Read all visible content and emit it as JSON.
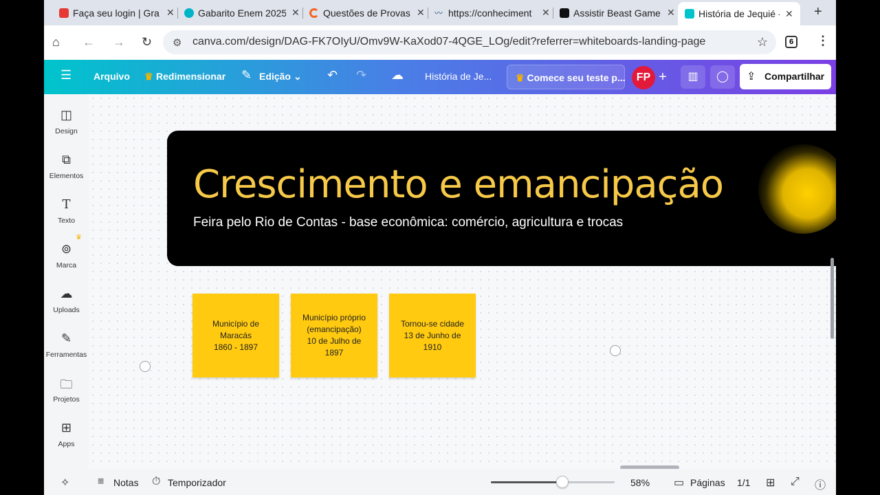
{
  "tabs": [
    {
      "title": "Faça seu login | Gra",
      "favicon_color": "#e53935"
    },
    {
      "title": "Gabarito Enem 2025",
      "favicon_color": "#00b3c7"
    },
    {
      "title": "Questões de Provas",
      "favicon_color": "#f26522"
    },
    {
      "title": "https://conheciment",
      "favicon_color": "#1e4a7a"
    },
    {
      "title": "Assistir Beast Game",
      "favicon_color": "#111111"
    },
    {
      "title": "História de Jequié -",
      "favicon_color": "#00c4cc"
    }
  ],
  "address": {
    "url": "canva.com/design/DAG-FK7OIyU/Omv9W-KaXod07-4QGE_LOg/edit?referrer=whiteboards-landing-page",
    "tab_count": "6"
  },
  "toolbar": {
    "file": "Arquivo",
    "resize": "Redimensionar",
    "edit": "Edição",
    "doc_title": "História de Je...",
    "trial": "Comece seu teste p...",
    "avatar": "FP",
    "share": "Compartilhar"
  },
  "sidebar": {
    "items": [
      {
        "label": "Design",
        "icon": "design-icon"
      },
      {
        "label": "Elementos",
        "icon": "elements-icon"
      },
      {
        "label": "Texto",
        "icon": "text-icon"
      },
      {
        "label": "Marca",
        "icon": "brand-icon"
      },
      {
        "label": "Uploads",
        "icon": "upload-icon"
      },
      {
        "label": "Ferramentas",
        "icon": "tools-icon"
      },
      {
        "label": "Projetos",
        "icon": "folder-icon"
      },
      {
        "label": "Apps",
        "icon": "apps-icon"
      }
    ]
  },
  "canvas": {
    "title": "Crescimento e emancipação",
    "subtitle": "Feira pelo Rio de Contas - base econômica: comércio, agricultura e trocas",
    "notes": [
      {
        "text": "Município de\nMaracás\n1860 - 1897"
      },
      {
        "text": "Município próprio\n(emancipação)\n10 de Julho de\n1897"
      },
      {
        "text": "Tornou-se cidade\n13 de Junho de\n1910"
      }
    ],
    "note_color": "#ffca10",
    "title_color": "#f7c948"
  },
  "bottom": {
    "notes": "Notas",
    "timer": "Temporizador",
    "zoom": "58%",
    "zoom_value": 0.58,
    "pages": "Páginas",
    "page_count": "1/1"
  }
}
